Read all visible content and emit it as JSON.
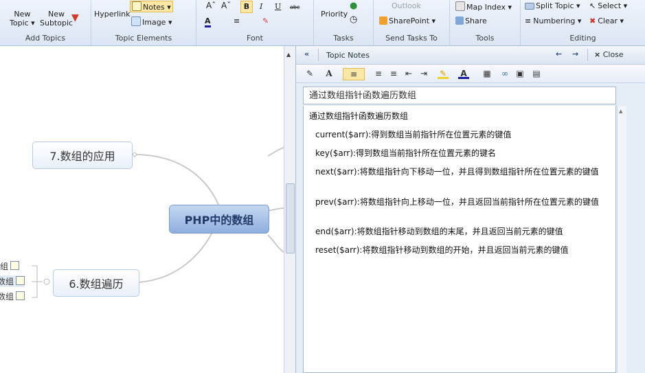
{
  "ribbon": {
    "groups": {
      "add_topics": "Add Topics",
      "topic_elements": "Topic Elements",
      "font": "Font",
      "tasks": "Tasks",
      "send_tasks_to": "Send Tasks To",
      "tools": "Tools",
      "editing": "Editing"
    },
    "new_topic": [
      "New",
      "Topic ▾"
    ],
    "new_subtopic": [
      "New",
      "Subtopic"
    ],
    "hyperlink": "Hyperlink",
    "notes": "Notes ▾",
    "image": "Image ▾",
    "priority": "Priority",
    "outlook": "Outlook",
    "sharepoint": "SharePoint ▾",
    "map_index": "Map Index ▾",
    "share": "Share",
    "split_topic": "Split Topic ▾",
    "numbering": "Numbering ▾",
    "select": "Select ▾",
    "clear": "Clear ▾"
  },
  "map": {
    "central": "PHP中的数组",
    "topic7": "7.数组的应用",
    "topic6": "6.数组遍历",
    "sub_items": [
      "数组",
      "数组",
      "数组"
    ]
  },
  "pane": {
    "header": "Topic Notes",
    "close": "Close",
    "title": "通过数组指针函数遍历数组",
    "lines": [
      "通过数组指针函数遍历数组",
      "current($arr):得到数组当前指针所在位置元素的键值",
      "key($arr):得到数组当前指针所在位置元素的键名",
      "next($arr):将数组指针向下移动一位，并且得到数组指针所在位置元素的键值",
      "prev($arr):将数组指针向上移动一位，并且返回当前指针所在位置元素的键值",
      "end($arr):将数组指针移动到数组的末尾，并且返回当前元素的键值",
      "reset($arr):将数组指针移动到数组的开始，并且返回当前元素的键值"
    ]
  }
}
